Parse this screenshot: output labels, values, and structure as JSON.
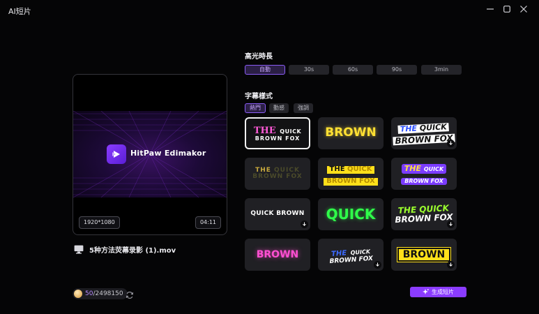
{
  "app": {
    "title": "AI短片"
  },
  "window": {
    "minimize_icon": "minimize-icon",
    "maximize_icon": "maximize-icon",
    "close_icon": "close-icon"
  },
  "preview": {
    "brand_name": "HitPaw Edimakor",
    "resolution": "1920*1080",
    "duration": "04:11",
    "file_name": "5种方法荧幕录影 (1).mov"
  },
  "credits": {
    "used": "50",
    "total": "/2498150"
  },
  "highlight_duration": {
    "title": "高光時長",
    "options": [
      {
        "label": "自動",
        "active": true
      },
      {
        "label": "30s",
        "active": false
      },
      {
        "label": "60s",
        "active": false
      },
      {
        "label": "90s",
        "active": false
      },
      {
        "label": "3min",
        "active": false
      }
    ]
  },
  "caption_style": {
    "title": "字幕樣式",
    "tabs": [
      {
        "label": "熱門",
        "active": true
      },
      {
        "label": "動感",
        "active": false
      },
      {
        "label": "強調",
        "active": false
      }
    ],
    "tiles": [
      {
        "texts": [
          "THE",
          "QUICK",
          "BROWN FOX"
        ],
        "selected": true,
        "download": false
      },
      {
        "texts": [
          "BROWN"
        ],
        "selected": false,
        "download": false
      },
      {
        "texts": [
          "THE",
          "QUICK",
          "BROWN FOX"
        ],
        "selected": false,
        "download": true
      },
      {
        "texts": [
          "THE",
          "QUICK",
          "BROWN FOX"
        ],
        "selected": false,
        "download": false
      },
      {
        "texts": [
          "THE",
          "QUICK",
          "BROWN FOX"
        ],
        "selected": false,
        "download": false
      },
      {
        "texts": [
          "THE",
          "QUICK",
          "BROWN FOX"
        ],
        "selected": false,
        "download": false
      },
      {
        "texts": [
          "QUICK BROWN"
        ],
        "selected": false,
        "download": true
      },
      {
        "texts": [
          "QUICK"
        ],
        "selected": false,
        "download": false
      },
      {
        "texts": [
          "THE QUICK",
          "BROWN FOX"
        ],
        "selected": false,
        "download": true
      },
      {
        "texts": [
          "BROWN"
        ],
        "selected": false,
        "download": false
      },
      {
        "texts": [
          "THE",
          "QUICK",
          "BROWN FOX"
        ],
        "selected": false,
        "download": true
      },
      {
        "texts": [
          "BROWN"
        ],
        "selected": false,
        "download": true
      }
    ]
  },
  "generate_button": {
    "label": "生成短片"
  },
  "colors": {
    "accent": "#8b3cff",
    "accent_text": "#c9a8ff",
    "background": "#050506"
  }
}
